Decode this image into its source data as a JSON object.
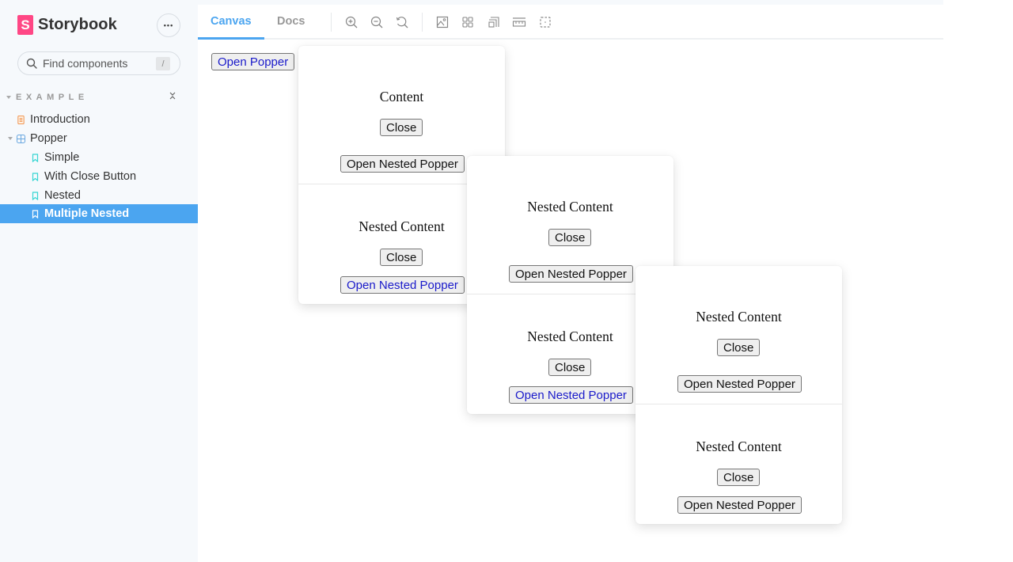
{
  "app": {
    "brand": "Storybook",
    "brand_logo_letter": "S",
    "menu_label": "•••"
  },
  "search": {
    "placeholder": "Find components",
    "shortcut": "/"
  },
  "sidebar": {
    "group_label": "EXAMPLE",
    "items": [
      {
        "label": "Introduction",
        "icon": "document-icon",
        "level": 0
      },
      {
        "label": "Popper",
        "icon": "component-icon",
        "level": 0,
        "expanded": true
      },
      {
        "label": "Simple",
        "icon": "bookmark-icon",
        "level": 1
      },
      {
        "label": "With Close Button",
        "icon": "bookmark-icon",
        "level": 1
      },
      {
        "label": "Nested",
        "icon": "bookmark-icon",
        "level": 1
      },
      {
        "label": "Multiple Nested",
        "icon": "bookmark-icon",
        "level": 1,
        "selected": true
      }
    ]
  },
  "toolbar": {
    "tabs": [
      {
        "label": "Canvas",
        "active": true
      },
      {
        "label": "Docs",
        "active": false
      }
    ],
    "tools": [
      "zoom-in-icon",
      "zoom-out-icon",
      "zoom-reset-icon",
      "background-icon",
      "grid-icon",
      "viewport-icon",
      "measure-icon",
      "outline-icon"
    ]
  },
  "canvas": {
    "open_popper_label": "Open Popper",
    "poppers": [
      {
        "sections": [
          {
            "title": "Content",
            "close": "Close",
            "open_nested": "Open Nested Popper",
            "open_nested_active": false
          },
          {
            "title": "Nested Content",
            "close": "Close",
            "open_nested": "Open Nested Popper",
            "open_nested_active": true
          }
        ]
      },
      {
        "sections": [
          {
            "title": "Nested Content",
            "close": "Close",
            "open_nested": "Open Nested Popper",
            "open_nested_active": false
          },
          {
            "title": "Nested Content",
            "close": "Close",
            "open_nested": "Open Nested Popper",
            "open_nested_active": true
          }
        ]
      },
      {
        "sections": [
          {
            "title": "Nested Content",
            "close": "Close",
            "open_nested": "Open Nested Popper",
            "open_nested_active": false
          },
          {
            "title": "Nested Content",
            "close": "Close",
            "open_nested": "Open Nested Popper",
            "open_nested_active": false
          }
        ]
      }
    ]
  },
  "colors": {
    "accent": "#4ba5f0",
    "brand": "#ff4785",
    "link_button_text": "#1a1aca"
  }
}
